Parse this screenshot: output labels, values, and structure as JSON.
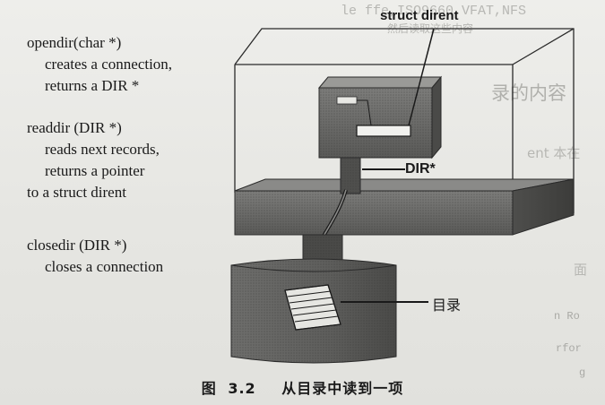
{
  "functions": [
    {
      "signature": "opendir(char *)",
      "lines": [
        "creates a connection,",
        "returns a DIR *"
      ]
    },
    {
      "signature": "readdir (DIR *)",
      "lines": [
        "reads next records,",
        "returns a pointer"
      ],
      "continuation": "to a struct dirent"
    },
    {
      "signature": "closedir (DIR *)",
      "lines": [
        "closes a connection"
      ]
    }
  ],
  "labels": {
    "struct_dirent": "struct dirent",
    "dir_pointer": "DIR*",
    "directory": "目录"
  },
  "caption": {
    "figure_label": "图",
    "figure_number": "3.2",
    "title": "从目录中读到一项"
  },
  "background_ghost_text": {
    "top": "le ffe,ISO9660,VFAT,NFS",
    "top_small": "然后读取这些内容",
    "heading": "录的内容",
    "mid": "ent 本在",
    "mid2": "面",
    "code1": "n Ro",
    "code2": "rfor",
    "code3": "g"
  },
  "colors": {
    "box_dark": "#5c5c5a",
    "box_mid": "#7a7a78",
    "box_light": "#9a9a97",
    "outline": "#2a2a2a",
    "page": "#e9e9e6"
  }
}
